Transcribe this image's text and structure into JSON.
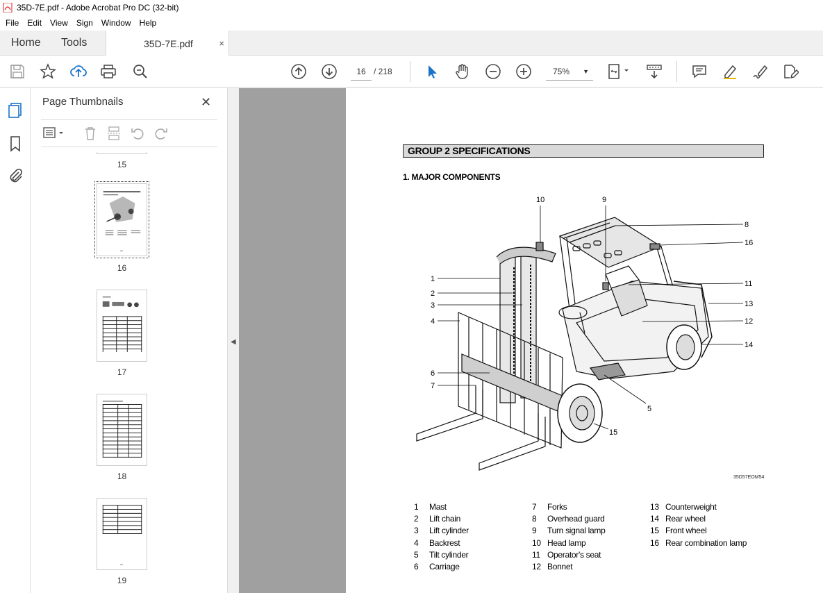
{
  "window": {
    "title": "35D-7E.pdf - Adobe Acrobat Pro DC (32-bit)"
  },
  "menu": {
    "items": [
      "File",
      "Edit",
      "View",
      "Sign",
      "Window",
      "Help"
    ]
  },
  "tabs": {
    "home": "Home",
    "tools": "Tools",
    "document": "35D-7E.pdf",
    "close_glyph": "×"
  },
  "toolbar": {
    "current_page": "16",
    "page_total": "/ 218",
    "zoom": "75%"
  },
  "thumbnails_panel": {
    "title": "Page Thumbnails",
    "pages": [
      "15",
      "16",
      "17",
      "18",
      "19"
    ],
    "selected_page": "16"
  },
  "document": {
    "group_header": "GROUP 2  SPECIFICATIONS",
    "section_title": "1. MAJOR COMPONENTS",
    "figure_code": "35D57EOM54",
    "callout_numbers": [
      "10",
      "9",
      "8",
      "16",
      "1",
      "2",
      "3",
      "4",
      "11",
      "13",
      "12",
      "14",
      "6",
      "7",
      "5",
      "15"
    ],
    "components": [
      {
        "num": "1",
        "name": "Mast"
      },
      {
        "num": "2",
        "name": "Lift chain"
      },
      {
        "num": "3",
        "name": "Lift cylinder"
      },
      {
        "num": "4",
        "name": "Backrest"
      },
      {
        "num": "5",
        "name": "Tilt cylinder"
      },
      {
        "num": "6",
        "name": "Carriage"
      },
      {
        "num": "7",
        "name": "Forks"
      },
      {
        "num": "8",
        "name": "Overhead guard"
      },
      {
        "num": "9",
        "name": "Turn signal lamp"
      },
      {
        "num": "10",
        "name": "Head lamp"
      },
      {
        "num": "11",
        "name": "Operator's seat"
      },
      {
        "num": "12",
        "name": "Bonnet"
      },
      {
        "num": "13",
        "name": "Counterweight"
      },
      {
        "num": "14",
        "name": "Rear wheel"
      },
      {
        "num": "15",
        "name": "Front wheel"
      },
      {
        "num": "16",
        "name": "Rear combination lamp"
      }
    ]
  },
  "colors": {
    "viewer_bg": "#a0a0a0",
    "accent": "#1a73c9",
    "header_fill": "#d9d9d9"
  }
}
